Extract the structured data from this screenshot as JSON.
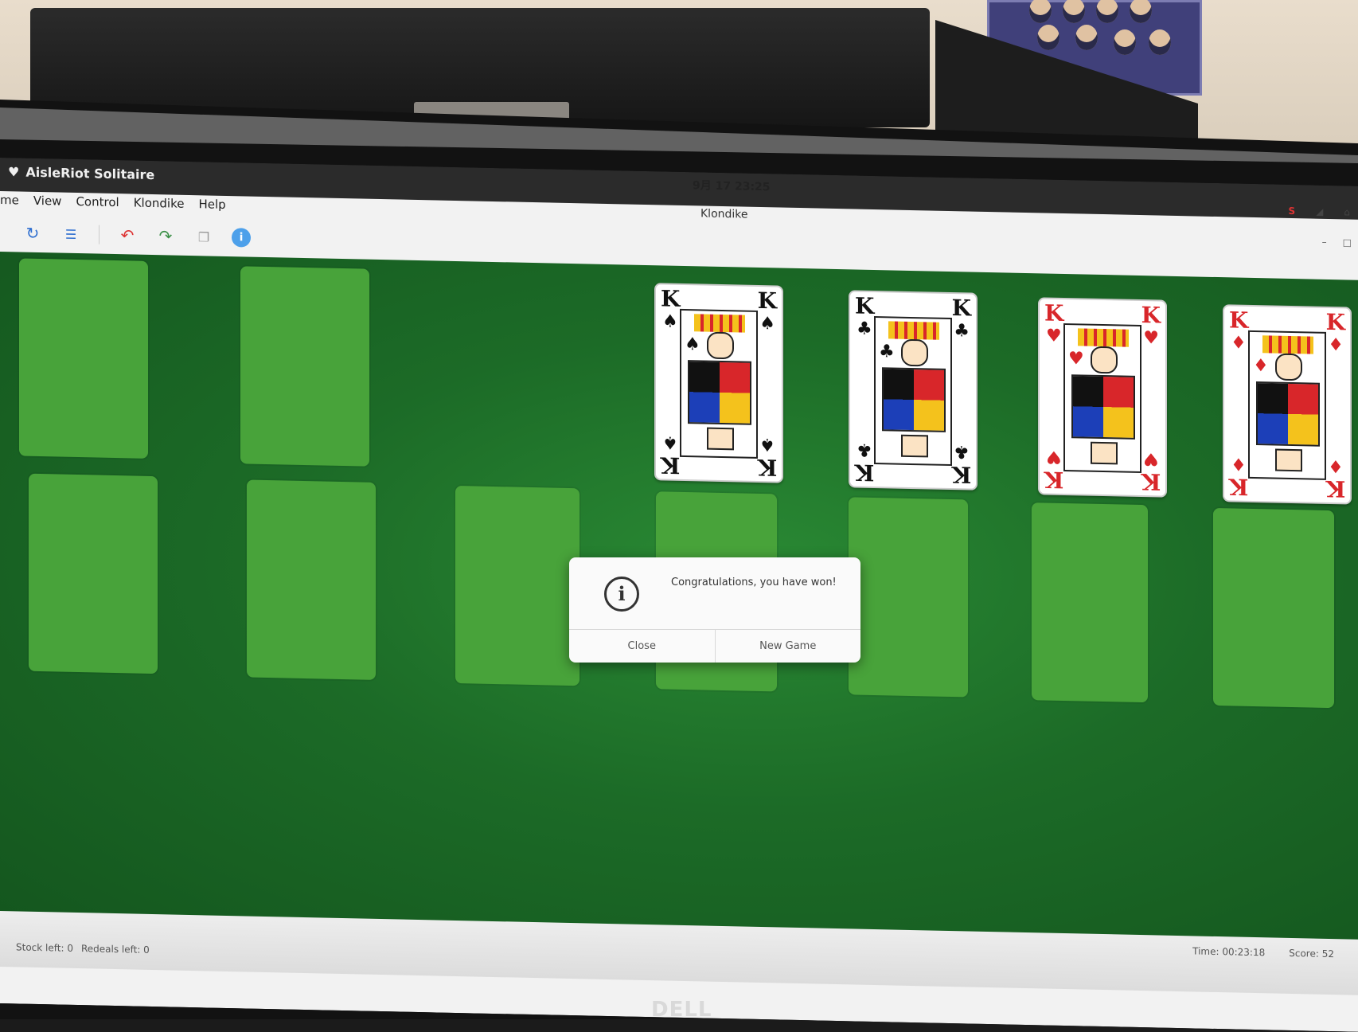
{
  "app": {
    "title": "AisleRiot Solitaire"
  },
  "system": {
    "clock": "9月 17 23:25"
  },
  "window": {
    "title": "Klondike"
  },
  "menu": {
    "items": [
      "me",
      "View",
      "Control",
      "Klondike",
      "Help"
    ]
  },
  "board": {
    "foundations": [
      {
        "rank": "K",
        "suit": "♠",
        "color": "#111111"
      },
      {
        "rank": "K",
        "suit": "♣",
        "color": "#111111"
      },
      {
        "rank": "K",
        "suit": "♥",
        "color": "#d8262a"
      },
      {
        "rank": "K",
        "suit": "♦",
        "color": "#d8262a"
      }
    ]
  },
  "dialog": {
    "message": "Congratulations, you have won!",
    "close_label": "Close",
    "new_game_label": "New Game"
  },
  "statusbar": {
    "stock_left": "Stock left: 0",
    "redeals_left": "Redeals left: 0",
    "time": "Time:   00:23:18",
    "score": "Score:   52"
  },
  "monitor": {
    "brand": "DELL"
  },
  "background": {
    "whiteboard_text": "...",
    "scribble": ""
  }
}
